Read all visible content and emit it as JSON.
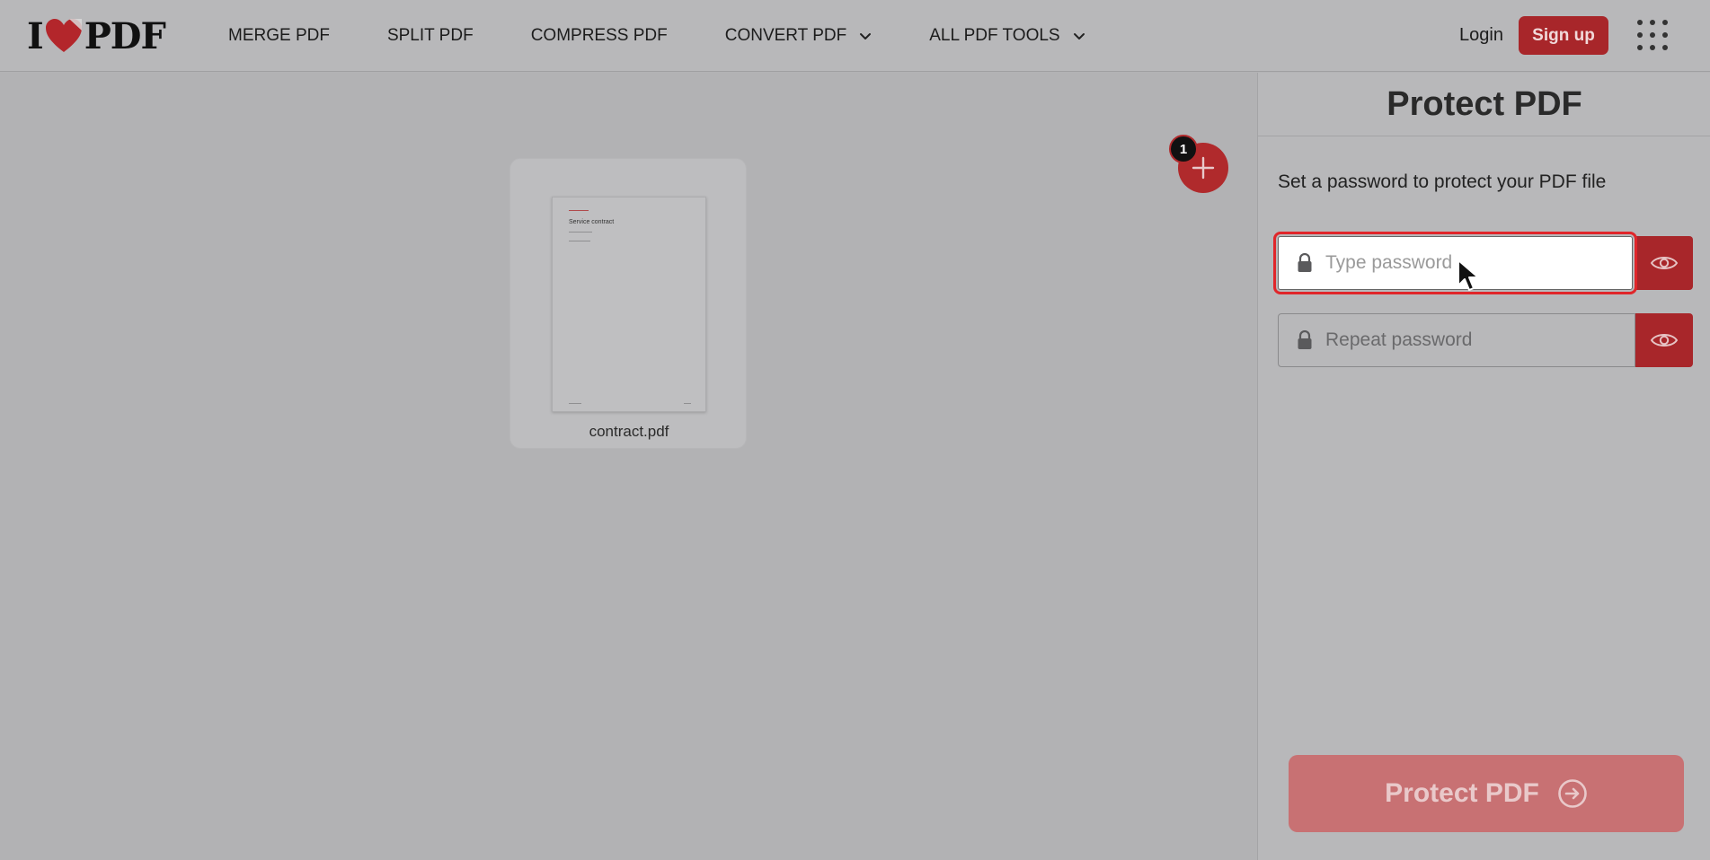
{
  "header": {
    "logo": {
      "left": "I",
      "right": "PDF"
    },
    "nav": [
      {
        "label": "MERGE PDF",
        "has_dropdown": false
      },
      {
        "label": "SPLIT PDF",
        "has_dropdown": false
      },
      {
        "label": "COMPRESS PDF",
        "has_dropdown": false
      },
      {
        "label": "CONVERT PDF",
        "has_dropdown": true
      },
      {
        "label": "ALL PDF TOOLS",
        "has_dropdown": true
      }
    ],
    "login_label": "Login",
    "signup_label": "Sign up",
    "apps_icon": "grid-icon"
  },
  "workspace": {
    "file": {
      "name": "contract.pdf",
      "thumbnail_title": "Service contract"
    },
    "file_count": "1",
    "add_icon": "plus-icon"
  },
  "sidebar": {
    "title": "Protect PDF",
    "description": "Set a password to protect your PDF file",
    "password": {
      "placeholder": "Type password",
      "value": ""
    },
    "repeat_password": {
      "placeholder": "Repeat password",
      "value": ""
    },
    "submit_label": "Protect PDF",
    "submit_icon": "arrow-right-circle-icon"
  },
  "colors": {
    "brand_red": "#a8262a",
    "focus_outline": "#e0262a",
    "disabled_button": "#c87173"
  }
}
